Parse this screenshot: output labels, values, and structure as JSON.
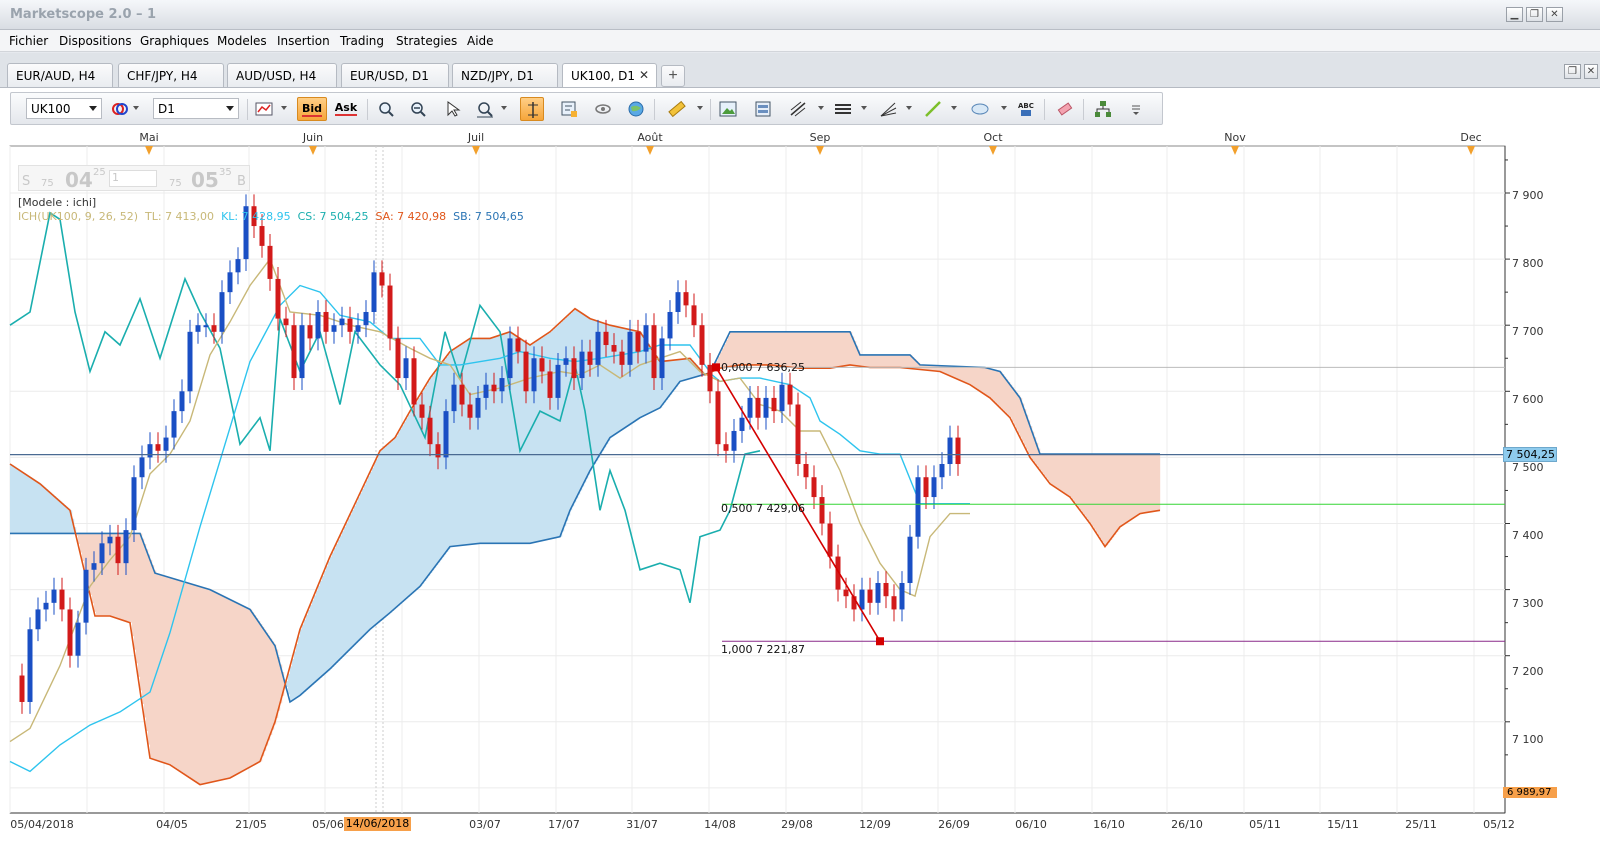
{
  "window": {
    "title": "Marketscope 2.0 – 1"
  },
  "menu": [
    "Fichier",
    "Dispositions",
    "Graphiques",
    "Modeles",
    "Insertion",
    "Trading",
    "Strategies",
    "Aide"
  ],
  "tabs": [
    {
      "label": "EUR/AUD, H4",
      "active": false
    },
    {
      "label": "CHF/JPY, H4",
      "active": false
    },
    {
      "label": "AUD/USD, H4",
      "active": false
    },
    {
      "label": "EUR/USD, D1",
      "active": false
    },
    {
      "label": "NZD/JPY, D1",
      "active": false
    },
    {
      "label": "UK100, D1",
      "active": true
    }
  ],
  "toolbar": {
    "instrument": "UK100",
    "timeframe": "D1",
    "bid_label": "Bid",
    "ask_label": "Ask",
    "icons": [
      "chart-type-icon",
      "bid-icon",
      "ask-icon",
      "zoom-in-icon",
      "zoom-out-icon",
      "cursor-icon",
      "zoom-box-icon",
      "crosshair-icon",
      "properties-icon",
      "eye-icon",
      "globe-icon",
      "ruler-icon",
      "image-icon",
      "dashboard-icon",
      "trend-lines-icon",
      "horizontal-lines-icon",
      "fan-icon",
      "line-draw-icon",
      "ellipse-icon",
      "text-icon",
      "eraser-icon",
      "hierarchy-icon",
      "more-icon"
    ]
  },
  "chart": {
    "months": [
      "Mai",
      "Juin",
      "Juil",
      "Août",
      "Sep",
      "Oct",
      "Nov",
      "Dec"
    ],
    "y_ticks": [
      "7 900",
      "7 800",
      "7 700",
      "7 600",
      "7 500",
      "7 400",
      "7 300",
      "7 200",
      "7 100"
    ],
    "current_price": "7 504,25",
    "bottom_price": "6 989,97",
    "x_dates": [
      "05/04/2018",
      "04/05",
      "21/05",
      "05/06",
      "03/07",
      "17/07",
      "31/07",
      "14/08",
      "29/08",
      "12/09",
      "26/09",
      "06/10",
      "16/10",
      "26/10",
      "05/11",
      "15/11",
      "25/11",
      "05/12"
    ],
    "highlight_date": "14/06/2018",
    "ticker": {
      "s": "S",
      "b": "B",
      "small1": "75",
      "big1": "04",
      "sup1": "25",
      "box": "1",
      "small2": "75",
      "big2": "05",
      "sup2": "35"
    },
    "model_label": "[Modele : ichi]",
    "ich_legend": {
      "name": "ICH(UK100, 9, 26, 52)",
      "tl": "TL: 7 413,00",
      "kl": "KL: 7 428,95",
      "cs": "CS: 7 504,25",
      "sa": "SA: 7 420,98",
      "sb": "SB: 7 504,65"
    },
    "fib": [
      {
        "label": "0,000 7 636,25"
      },
      {
        "label": "0,500 7 429,06"
      },
      {
        "label": "1,000 7 221,87"
      }
    ],
    "colors": {
      "bull": "#1a4fc4",
      "bear": "#d21a1a",
      "tenkan": "#c8b878",
      "kijun": "#2ec4ee",
      "chikou": "#1aaeae",
      "senkou_a": "#e0561a",
      "senkou_b": "#2a74b4",
      "bull_cloud": "#c7e2f2",
      "bear_cloud": "#f6d5c8",
      "fib_line": "#d40000"
    }
  }
}
